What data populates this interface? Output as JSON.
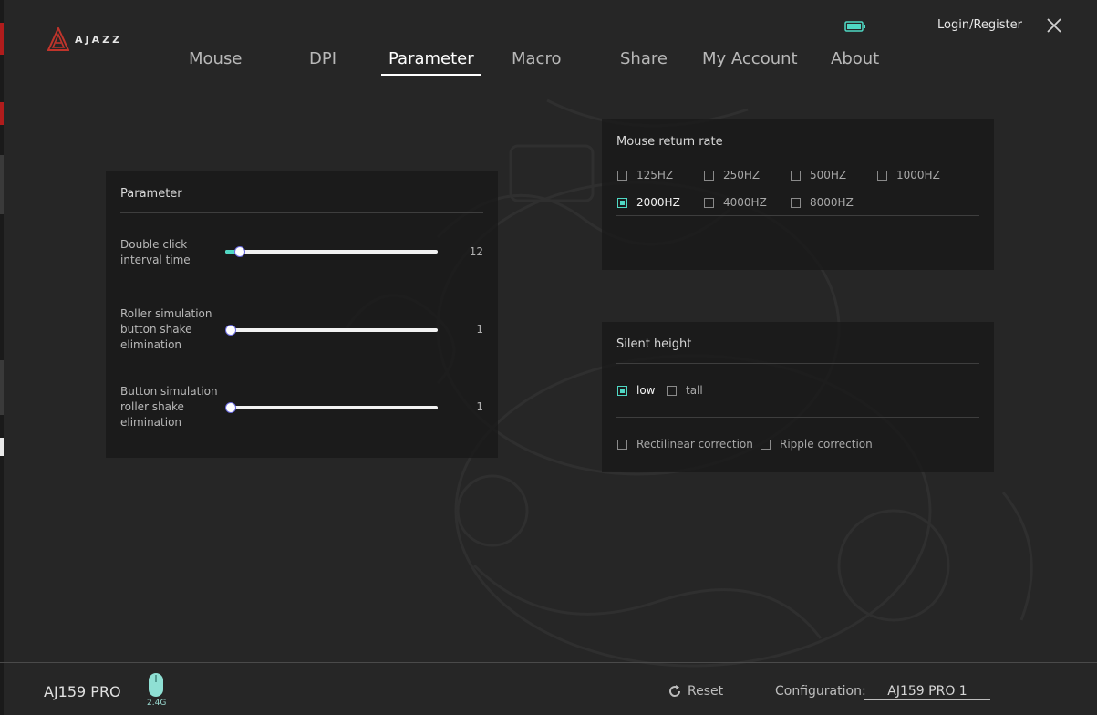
{
  "app": {
    "brand": "AJAZZ",
    "login": "Login/Register"
  },
  "nav": {
    "tabs": [
      {
        "label": "Mouse"
      },
      {
        "label": "DPI"
      },
      {
        "label": "Parameter",
        "active": true
      },
      {
        "label": "Macro"
      },
      {
        "label": "Share"
      },
      {
        "label": "My Account"
      },
      {
        "label": "About"
      }
    ]
  },
  "parameter": {
    "title": "Parameter",
    "items": [
      {
        "label": "Double click interval time",
        "value": "12",
        "fill": 0.06
      },
      {
        "label": "Roller simulation button shake elimination",
        "value": "1",
        "fill": 0.0
      },
      {
        "label": "Button simulation roller shake elimination",
        "value": "1",
        "fill": 0.0
      }
    ]
  },
  "return_rate": {
    "title": "Mouse return rate",
    "options": [
      {
        "label": "125HZ",
        "checked": false
      },
      {
        "label": "250HZ",
        "checked": false
      },
      {
        "label": "500HZ",
        "checked": false
      },
      {
        "label": "1000HZ",
        "checked": false
      },
      {
        "label": "2000HZ",
        "checked": true
      },
      {
        "label": "4000HZ",
        "checked": false
      },
      {
        "label": "8000HZ",
        "checked": false
      }
    ]
  },
  "silent": {
    "title": "Silent height",
    "heights": [
      {
        "label": "low",
        "checked": true
      },
      {
        "label": "tall",
        "checked": false
      }
    ],
    "corrections": [
      {
        "label": "Rectilinear correction",
        "checked": false
      },
      {
        "label": "Ripple correction",
        "checked": false
      }
    ]
  },
  "footer": {
    "model": "AJ159 PRO",
    "connection": "2.4G",
    "reset": "Reset",
    "config_label": "Configuration:",
    "config_value": "AJ159 PRO 1"
  },
  "colors": {
    "accent": "#4fd8c4",
    "background": "#262626",
    "panel": "#1a1a1a"
  }
}
